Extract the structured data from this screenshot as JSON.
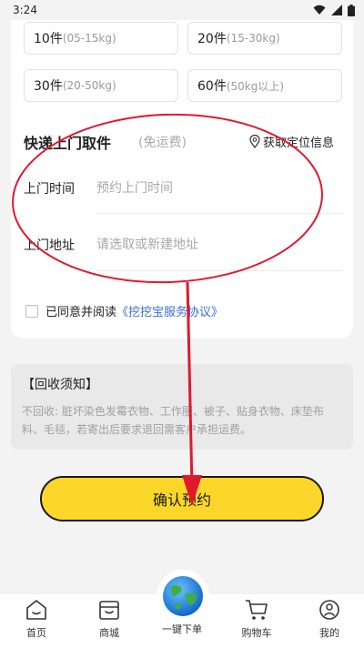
{
  "status": {
    "time": "3:24"
  },
  "weights": [
    {
      "count": "10件",
      "range": "(05-15kg)"
    },
    {
      "count": "20件",
      "range": "(15-30kg)"
    },
    {
      "count": "30件",
      "range": "(20-50kg)"
    },
    {
      "count": "60件",
      "range": "(50kg以上)"
    }
  ],
  "pickup": {
    "title": "快递上门取件",
    "subtitle": "(免运费)",
    "locate_label": "获取定位信息",
    "time_label": "上门时间",
    "time_placeholder": "预约上门时间",
    "address_label": "上门地址",
    "address_placeholder": "请选取或新建地址"
  },
  "agreement": {
    "prefix": "已同意并阅读",
    "link": "《挖挖宝服务协议》"
  },
  "notice": {
    "title": "【回收须知】",
    "text": "不回收: 脏坏染色发霉衣物、工作服、被子、贴身衣物、床垫布料、毛毯，若寄出后要求退回需客户承担运费。"
  },
  "confirm_label": "确认预约",
  "tabs": [
    {
      "label": "首页",
      "icon": "home-icon"
    },
    {
      "label": "商城",
      "icon": "shop-icon"
    },
    {
      "label": "一键下单",
      "icon": "globe-icon"
    },
    {
      "label": "购物车",
      "icon": "cart-icon"
    },
    {
      "label": "我的",
      "icon": "user-icon"
    }
  ],
  "colors": {
    "accent": "#fcd72a",
    "link": "#3a6fd8",
    "annotation": "#e0182e"
  }
}
